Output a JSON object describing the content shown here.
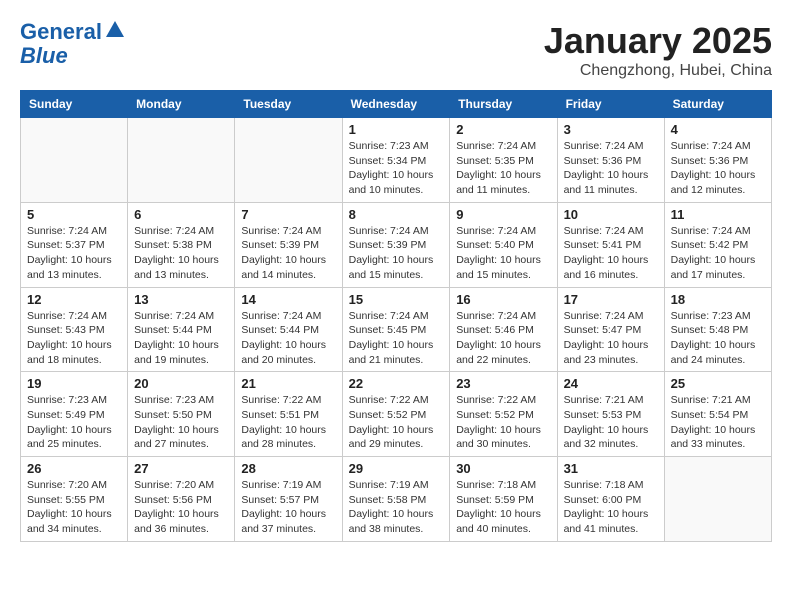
{
  "header": {
    "logo_line1": "General",
    "logo_line2": "Blue",
    "month": "January 2025",
    "location": "Chengzhong, Hubei, China"
  },
  "weekdays": [
    "Sunday",
    "Monday",
    "Tuesday",
    "Wednesday",
    "Thursday",
    "Friday",
    "Saturday"
  ],
  "weeks": [
    [
      {
        "day": "",
        "info": ""
      },
      {
        "day": "",
        "info": ""
      },
      {
        "day": "",
        "info": ""
      },
      {
        "day": "1",
        "info": "Sunrise: 7:23 AM\nSunset: 5:34 PM\nDaylight: 10 hours\nand 10 minutes."
      },
      {
        "day": "2",
        "info": "Sunrise: 7:24 AM\nSunset: 5:35 PM\nDaylight: 10 hours\nand 11 minutes."
      },
      {
        "day": "3",
        "info": "Sunrise: 7:24 AM\nSunset: 5:36 PM\nDaylight: 10 hours\nand 11 minutes."
      },
      {
        "day": "4",
        "info": "Sunrise: 7:24 AM\nSunset: 5:36 PM\nDaylight: 10 hours\nand 12 minutes."
      }
    ],
    [
      {
        "day": "5",
        "info": "Sunrise: 7:24 AM\nSunset: 5:37 PM\nDaylight: 10 hours\nand 13 minutes."
      },
      {
        "day": "6",
        "info": "Sunrise: 7:24 AM\nSunset: 5:38 PM\nDaylight: 10 hours\nand 13 minutes."
      },
      {
        "day": "7",
        "info": "Sunrise: 7:24 AM\nSunset: 5:39 PM\nDaylight: 10 hours\nand 14 minutes."
      },
      {
        "day": "8",
        "info": "Sunrise: 7:24 AM\nSunset: 5:39 PM\nDaylight: 10 hours\nand 15 minutes."
      },
      {
        "day": "9",
        "info": "Sunrise: 7:24 AM\nSunset: 5:40 PM\nDaylight: 10 hours\nand 15 minutes."
      },
      {
        "day": "10",
        "info": "Sunrise: 7:24 AM\nSunset: 5:41 PM\nDaylight: 10 hours\nand 16 minutes."
      },
      {
        "day": "11",
        "info": "Sunrise: 7:24 AM\nSunset: 5:42 PM\nDaylight: 10 hours\nand 17 minutes."
      }
    ],
    [
      {
        "day": "12",
        "info": "Sunrise: 7:24 AM\nSunset: 5:43 PM\nDaylight: 10 hours\nand 18 minutes."
      },
      {
        "day": "13",
        "info": "Sunrise: 7:24 AM\nSunset: 5:44 PM\nDaylight: 10 hours\nand 19 minutes."
      },
      {
        "day": "14",
        "info": "Sunrise: 7:24 AM\nSunset: 5:44 PM\nDaylight: 10 hours\nand 20 minutes."
      },
      {
        "day": "15",
        "info": "Sunrise: 7:24 AM\nSunset: 5:45 PM\nDaylight: 10 hours\nand 21 minutes."
      },
      {
        "day": "16",
        "info": "Sunrise: 7:24 AM\nSunset: 5:46 PM\nDaylight: 10 hours\nand 22 minutes."
      },
      {
        "day": "17",
        "info": "Sunrise: 7:24 AM\nSunset: 5:47 PM\nDaylight: 10 hours\nand 23 minutes."
      },
      {
        "day": "18",
        "info": "Sunrise: 7:23 AM\nSunset: 5:48 PM\nDaylight: 10 hours\nand 24 minutes."
      }
    ],
    [
      {
        "day": "19",
        "info": "Sunrise: 7:23 AM\nSunset: 5:49 PM\nDaylight: 10 hours\nand 25 minutes."
      },
      {
        "day": "20",
        "info": "Sunrise: 7:23 AM\nSunset: 5:50 PM\nDaylight: 10 hours\nand 27 minutes."
      },
      {
        "day": "21",
        "info": "Sunrise: 7:22 AM\nSunset: 5:51 PM\nDaylight: 10 hours\nand 28 minutes."
      },
      {
        "day": "22",
        "info": "Sunrise: 7:22 AM\nSunset: 5:52 PM\nDaylight: 10 hours\nand 29 minutes."
      },
      {
        "day": "23",
        "info": "Sunrise: 7:22 AM\nSunset: 5:52 PM\nDaylight: 10 hours\nand 30 minutes."
      },
      {
        "day": "24",
        "info": "Sunrise: 7:21 AM\nSunset: 5:53 PM\nDaylight: 10 hours\nand 32 minutes."
      },
      {
        "day": "25",
        "info": "Sunrise: 7:21 AM\nSunset: 5:54 PM\nDaylight: 10 hours\nand 33 minutes."
      }
    ],
    [
      {
        "day": "26",
        "info": "Sunrise: 7:20 AM\nSunset: 5:55 PM\nDaylight: 10 hours\nand 34 minutes."
      },
      {
        "day": "27",
        "info": "Sunrise: 7:20 AM\nSunset: 5:56 PM\nDaylight: 10 hours\nand 36 minutes."
      },
      {
        "day": "28",
        "info": "Sunrise: 7:19 AM\nSunset: 5:57 PM\nDaylight: 10 hours\nand 37 minutes."
      },
      {
        "day": "29",
        "info": "Sunrise: 7:19 AM\nSunset: 5:58 PM\nDaylight: 10 hours\nand 38 minutes."
      },
      {
        "day": "30",
        "info": "Sunrise: 7:18 AM\nSunset: 5:59 PM\nDaylight: 10 hours\nand 40 minutes."
      },
      {
        "day": "31",
        "info": "Sunrise: 7:18 AM\nSunset: 6:00 PM\nDaylight: 10 hours\nand 41 minutes."
      },
      {
        "day": "",
        "info": ""
      }
    ]
  ]
}
